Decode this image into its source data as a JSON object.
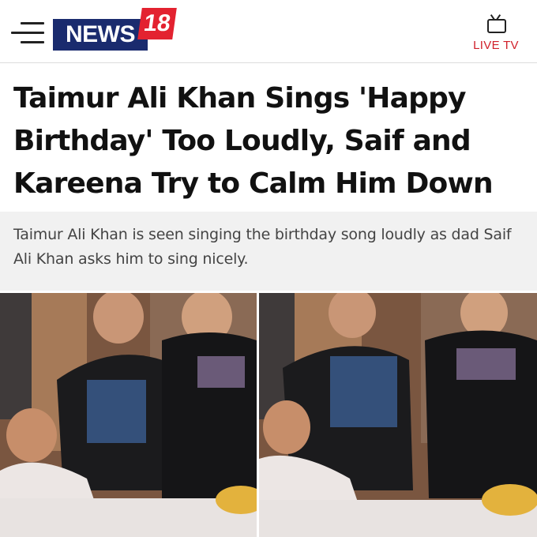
{
  "header": {
    "menu_icon": "hamburger-menu-icon",
    "logo": {
      "brand": "NEWS",
      "number": "18",
      "brand_color": "#1a2b6e",
      "number_color": "#e32230"
    },
    "live_tv": {
      "icon": "tv-icon",
      "label": "LIVE TV",
      "color": "#d0202a"
    }
  },
  "article": {
    "headline": "Taimur Ali Khan Sings 'Happy Birthday' Too Loudly, Saif and Kareena Try to Calm Him Down",
    "summary": "Taimur Ali Khan is seen singing the birthday song loudly as dad Saif Ali Khan asks him to sing nicely."
  },
  "images": [
    {
      "name": "birthday-photo-left"
    },
    {
      "name": "birthday-photo-right"
    }
  ]
}
